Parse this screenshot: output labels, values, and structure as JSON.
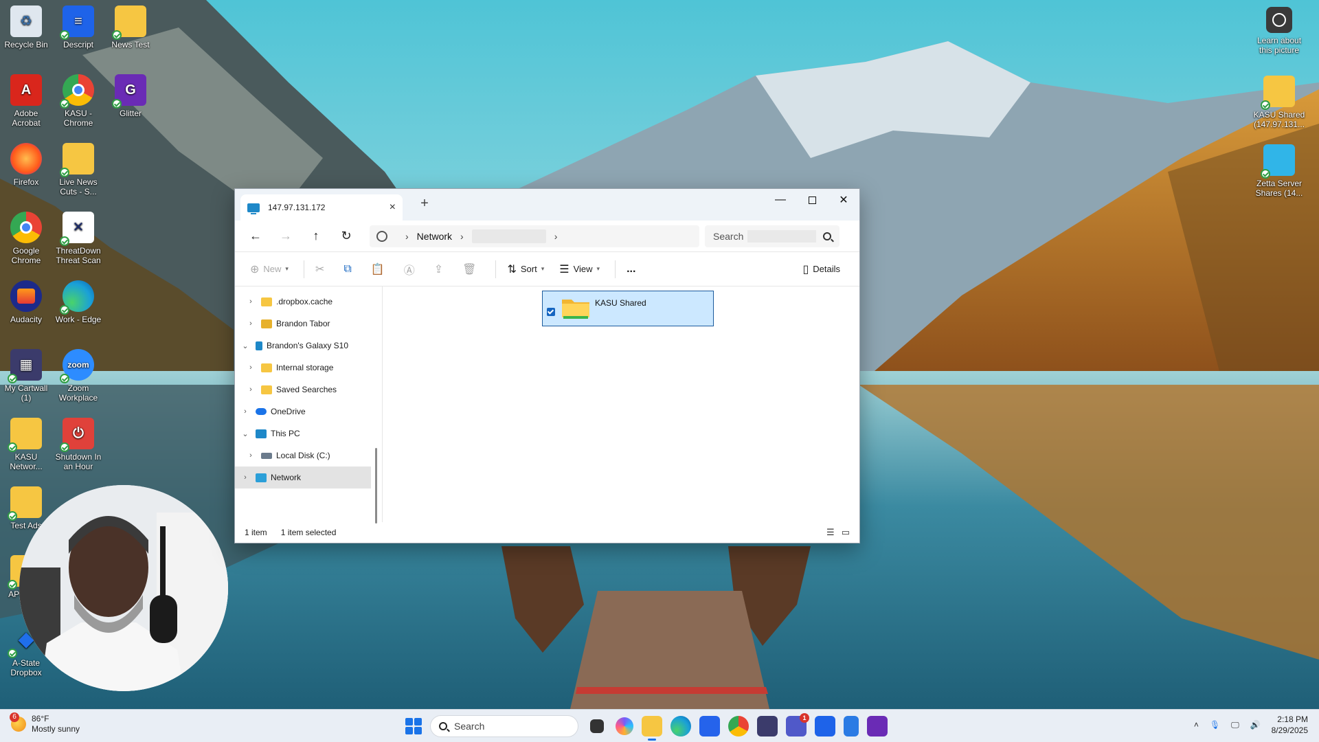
{
  "desktop": {
    "left_icons": [
      {
        "label": "Recycle Bin",
        "icon": "recycle-bin-icon",
        "color": "#dfe7ef"
      },
      {
        "label": "Descript",
        "icon": "descript-icon",
        "color": "#1e63e9"
      },
      {
        "label": "News Test",
        "icon": "folder-icon",
        "color": "#f6c642"
      },
      {
        "label": "Adobe Acrobat",
        "icon": "acrobat-icon",
        "color": "#d9261c"
      },
      {
        "label": "KASU - Chrome",
        "icon": "chrome-icon",
        "color": "#ffffff"
      },
      {
        "label": "Glitter",
        "icon": "glitter-icon",
        "color": "#6a2bb5"
      },
      {
        "label": "Firefox",
        "icon": "firefox-icon",
        "color": "#ff7a1a"
      },
      {
        "label": "Live News Cuts - S...",
        "icon": "folder-icon",
        "color": "#f6c642"
      },
      {
        "label": "Google Chrome",
        "icon": "chrome-icon",
        "color": "#ffffff"
      },
      {
        "label": "ThreatDown Threat Scan",
        "icon": "threatdown-icon",
        "color": "#ffffff"
      },
      {
        "label": "Audacity",
        "icon": "audacity-icon",
        "color": "#1c2a8a"
      },
      {
        "label": "Work - Edge",
        "icon": "edge-icon",
        "color": "#1aa0d8"
      },
      {
        "label": "My Cartwall (1)",
        "icon": "cartwall-icon",
        "color": "#3b3b6b"
      },
      {
        "label": "Zoom Workplace",
        "icon": "zoom-icon",
        "color": "#2d8cff"
      },
      {
        "label": "KASU Networ...",
        "icon": "folder-icon",
        "color": "#f6c642"
      },
      {
        "label": "Shutdown In an Hour",
        "icon": "power-icon",
        "color": "#e0413a"
      },
      {
        "label": "Test Ads",
        "icon": "folder-icon",
        "color": "#f6c642"
      },
      {
        "label": "AP SHUT",
        "icon": "shortcut-icon",
        "color": "#f6c642"
      },
      {
        "label": "A-State Dropbox",
        "icon": "dropbox-icon",
        "color": "#1f6feb"
      }
    ],
    "right_icons": [
      {
        "label": "Learn about this picture",
        "icon": "camera-icon",
        "color": "#3a3a3a"
      },
      {
        "label": "KASU Shared (147.97.131...",
        "icon": "folder-icon",
        "color": "#f6c642"
      },
      {
        "label": "Zetta Server Shares (14...",
        "icon": "network-drive-icon",
        "color": "#30b5e8"
      }
    ]
  },
  "explorer": {
    "tab_title": "147.97.131.172",
    "new_tab": "+",
    "address": {
      "segment": "Network"
    },
    "search_placeholder": "Search",
    "toolbar": {
      "new": "New",
      "sort": "Sort",
      "view": "View",
      "more": "...",
      "details": "Details"
    },
    "nav": [
      {
        "label": ".dropbox.cache",
        "indent": 1,
        "chevron": "›",
        "icon_color": "#f6c642"
      },
      {
        "label": "Brandon Tabor",
        "indent": 1,
        "chevron": "›",
        "icon_color": "#e7b12c"
      },
      {
        "label": "Brandon's Galaxy S10",
        "indent": 0,
        "chevron": "⌄",
        "icon_color": "#1e88c8"
      },
      {
        "label": "Internal storage",
        "indent": 1,
        "chevron": "›",
        "icon_color": "#f6c642"
      },
      {
        "label": "Saved Searches",
        "indent": 1,
        "chevron": "›",
        "icon_color": "#f6c642"
      },
      {
        "label": "OneDrive",
        "indent": 0,
        "chevron": "›",
        "icon_color": "#1a73e8"
      },
      {
        "label": "This PC",
        "indent": 0,
        "chevron": "⌄",
        "icon_color": "#1e88c8"
      },
      {
        "label": "Local Disk (C:)",
        "indent": 1,
        "chevron": "›",
        "icon_color": "#6b7b8c"
      },
      {
        "label": "Network",
        "indent": 0,
        "chevron": "›",
        "icon_color": "#2b9fd8",
        "selected": true
      }
    ],
    "items": [
      {
        "name": "KASU Shared"
      }
    ],
    "status": {
      "count": "1 item",
      "selection": "1 item selected"
    }
  },
  "taskbar": {
    "weather": {
      "temp": "86°F",
      "desc": "Mostly sunny",
      "badge": "6"
    },
    "search_label": "Search",
    "apps": [
      {
        "name": "task-view",
        "color": "#333333"
      },
      {
        "name": "copilot",
        "color": "#7a5af8"
      },
      {
        "name": "file-explorer",
        "color": "#f6c642",
        "active": true
      },
      {
        "name": "edge",
        "color": "#1aa0d8"
      },
      {
        "name": "store",
        "color": "#2563eb"
      },
      {
        "name": "chrome",
        "color": "#e94235"
      },
      {
        "name": "cartwall",
        "color": "#3b3b6b"
      },
      {
        "name": "teams",
        "color": "#5059c9",
        "badge": "1"
      },
      {
        "name": "descript",
        "color": "#1e63e9"
      },
      {
        "name": "notepad",
        "color": "#2b7be4"
      },
      {
        "name": "glitter",
        "color": "#6a2bb5"
      }
    ],
    "time": "2:18 PM",
    "date": "8/29/2025"
  }
}
